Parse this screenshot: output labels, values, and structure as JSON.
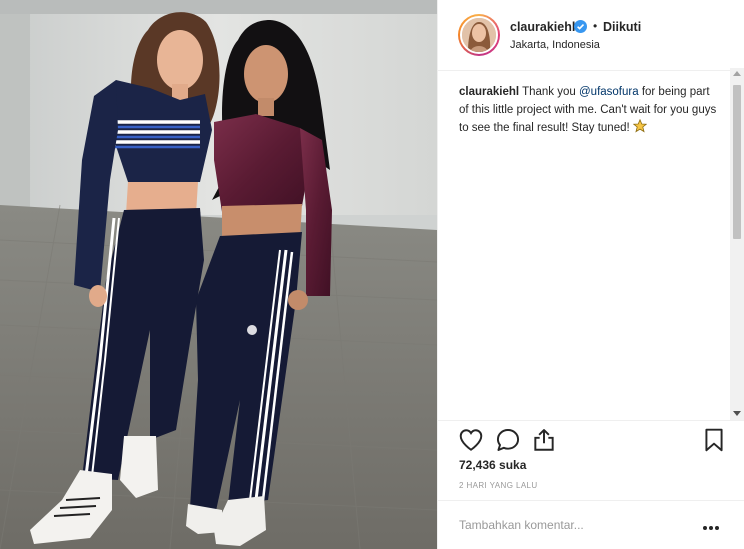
{
  "post": {
    "username": "claurakiehl",
    "follow_status": "Diikuti",
    "separator": "•",
    "location": "Jakarta, Indonesia",
    "caption": {
      "username": "claurakiehl",
      "text_before_mention": "Thank you ",
      "mention": "@ufasofura",
      "text_after_mention": " for being part of this little project with me. Can't wait for you guys to see the final result! Stay tuned! "
    },
    "likes": "72,436 suka",
    "timestamp": "2 HARI YANG LALU",
    "comment_placeholder": "Tambahkan komentar..."
  },
  "colors": {
    "accent_link": "#003569",
    "text_primary": "#262626",
    "text_secondary": "#999999",
    "verified_badge": "#3897f0",
    "divider": "#efefef"
  },
  "icons": {
    "verified": "verified-badge-icon",
    "like": "heart-outline-icon",
    "comment": "speech-bubble-icon",
    "share": "share-upload-icon",
    "save": "bookmark-icon",
    "more": "more-dots-icon",
    "emoji": "star-emoji-icon"
  }
}
